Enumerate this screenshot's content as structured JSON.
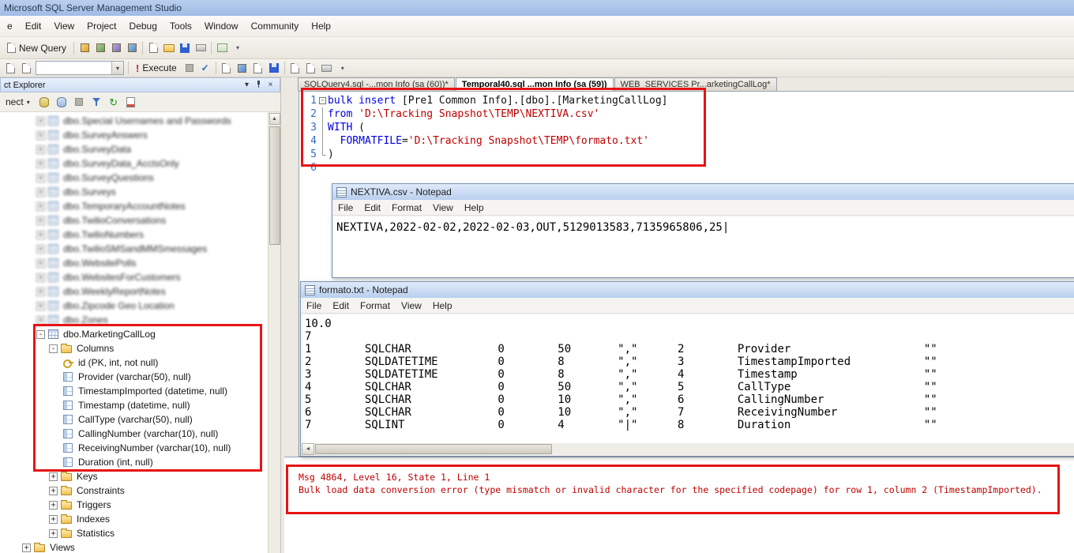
{
  "window": {
    "title": "Microsoft SQL Server Management Studio"
  },
  "menu": [
    "e",
    "Edit",
    "View",
    "Project",
    "Debug",
    "Tools",
    "Window",
    "Community",
    "Help"
  ],
  "toolbar": {
    "new_query": "New Query",
    "execute": "Execute",
    "db_combo_value": ""
  },
  "object_explorer": {
    "title": "ct Explorer",
    "connect": "nect",
    "blurred_items": [
      "dbo.Special Usernames and Passwords",
      "dbo.SurveyAnswers",
      "dbo.SurveyData",
      "dbo.SurveyData_AcctsOnly",
      "dbo.SurveyQuestions",
      "dbo.Surveys",
      "dbo.TemporaryAccountNotes",
      "dbo.TwilioConversations",
      "dbo.TwilioNumbers",
      "dbo.TwilioSMSandMMSmessages",
      "dbo.WebsitePolls",
      "dbo.WebsitesForCustomers",
      "dbo.WeeklyReportNotes",
      "dbo.Zipcode Geo Location",
      "dbo.Zones"
    ],
    "table": {
      "label": "dbo.MarketingCallLog",
      "columns_folder": "Columns",
      "columns": [
        {
          "name": "id (PK, int, not null)",
          "pk": true
        },
        {
          "name": "Provider (varchar(50), null)"
        },
        {
          "name": "TimestampImported (datetime, null)"
        },
        {
          "name": "Timestamp (datetime, null)"
        },
        {
          "name": "CallType (varchar(50), null)"
        },
        {
          "name": "CallingNumber (varchar(10), null)"
        },
        {
          "name": "ReceivingNumber (varchar(10), null)"
        },
        {
          "name": "Duration (int, null)"
        }
      ],
      "folders": [
        "Keys",
        "Constraints",
        "Triggers",
        "Indexes",
        "Statistics"
      ]
    },
    "views_label": "Views"
  },
  "editor": {
    "tabs": [
      {
        "label": "SQLQuery4.sql -...mon Info (sa (60))*",
        "active": false
      },
      {
        "label": "Temporal40.sql ...mon Info (sa (59))",
        "active": true
      },
      {
        "label": "WEB_SERVICES Pr...arketingCallLog*",
        "active": false
      }
    ],
    "lines": [
      {
        "n": "1",
        "tokens": [
          [
            "kw",
            "bulk insert"
          ],
          [
            "pl",
            " [Pre1 Common Info].[dbo].[MarketingCallLog]"
          ]
        ]
      },
      {
        "n": "2",
        "tokens": [
          [
            "kw",
            "from"
          ],
          [
            "pl",
            " "
          ],
          [
            "str",
            "'D:\\Tracking Snapshot\\TEMP\\NEXTIVA.csv'"
          ]
        ]
      },
      {
        "n": "3",
        "tokens": [
          [
            "kw",
            "WITH"
          ],
          [
            "pl",
            " ("
          ]
        ]
      },
      {
        "n": "4",
        "tokens": [
          [
            "pl",
            "  "
          ],
          [
            "kw",
            "FORMATFILE"
          ],
          [
            "pl",
            "="
          ],
          [
            "str",
            "'D:\\Tracking Snapshot\\TEMP\\formato.txt'"
          ]
        ]
      },
      {
        "n": "5",
        "tokens": [
          [
            "pl",
            ")"
          ]
        ]
      },
      {
        "n": "6",
        "tokens": []
      }
    ]
  },
  "notepad_csv": {
    "title": "NEXTIVA.csv - Notepad",
    "menu": [
      "File",
      "Edit",
      "Format",
      "View",
      "Help"
    ],
    "content": "NEXTIVA,2022-02-02,2022-02-03,OUT,5129013583,7135965806,25|"
  },
  "notepad_format": {
    "title": "formato.txt - Notepad",
    "menu": [
      "File",
      "Edit",
      "Format",
      "View",
      "Help"
    ],
    "header_lines": [
      "10.0",
      "7"
    ],
    "col_positions": [
      0,
      9,
      29,
      38,
      47,
      56,
      65,
      93
    ],
    "rows": [
      [
        "1",
        "SQLCHAR",
        "0",
        "50",
        "\",\"",
        "2",
        "Provider",
        "\"\""
      ],
      [
        "2",
        "SQLDATETIME",
        "0",
        "8",
        "\",\"",
        "3",
        "TimestampImported",
        "\"\""
      ],
      [
        "3",
        "SQLDATETIME",
        "0",
        "8",
        "\",\"",
        "4",
        "Timestamp",
        "\"\""
      ],
      [
        "4",
        "SQLCHAR",
        "0",
        "50",
        "\",\"",
        "5",
        "CallType",
        "\"\""
      ],
      [
        "5",
        "SQLCHAR",
        "0",
        "10",
        "\",\"",
        "6",
        "CallingNumber",
        "\"\""
      ],
      [
        "6",
        "SQLCHAR",
        "0",
        "10",
        "\",\"",
        "7",
        "ReceivingNumber",
        "\"\""
      ],
      [
        "7",
        "SQLINT",
        "0",
        "4",
        "\"|\"",
        "8",
        "Duration",
        "\"\""
      ]
    ]
  },
  "messages": {
    "lines": [
      "Msg 4864, Level 16, State 1, Line 1",
      "Bulk load data conversion error (type mismatch or invalid character for the specified codepage) for row 1, column 2 (TimestampImported)."
    ]
  }
}
